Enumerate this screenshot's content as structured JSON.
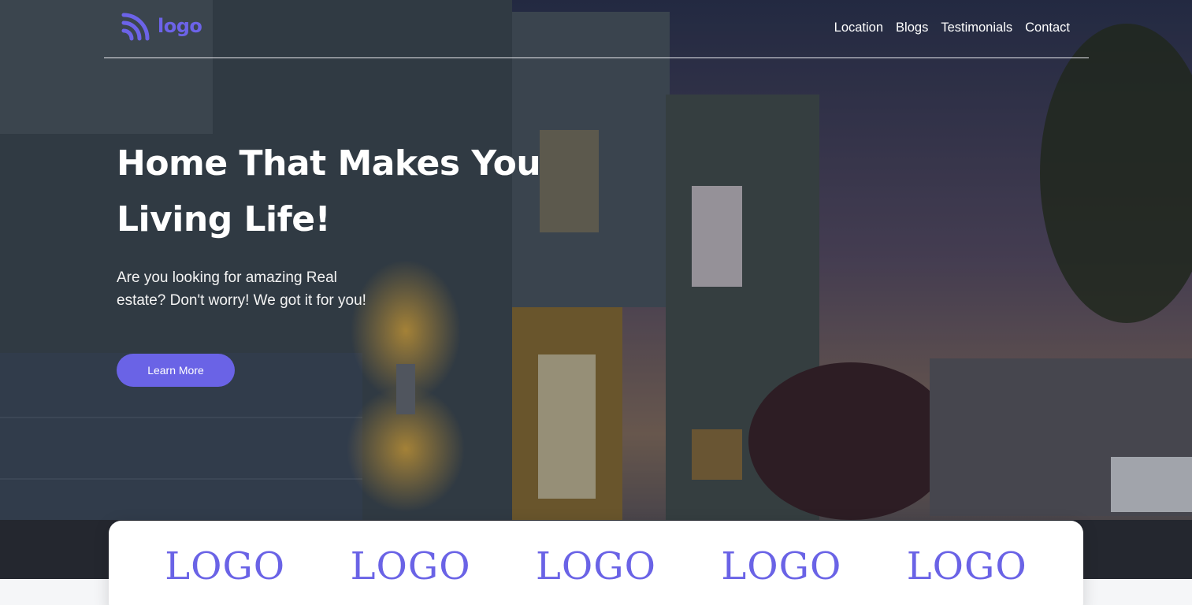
{
  "brand": {
    "logo_text": "logo",
    "accent": "#6a63e6"
  },
  "nav": {
    "items": [
      "Location",
      "Blogs",
      "Testimonials",
      "Contact"
    ]
  },
  "hero": {
    "headline_line1": "Home That Makes You",
    "headline_line2": "Living Life!",
    "subtext": "Are you looking for amazing Real estate? Don't worry! We got it for you!",
    "cta_label": "Learn More",
    "background_icon": "house-photo"
  },
  "partners": {
    "logos": [
      "LOGO",
      "LOGO",
      "LOGO",
      "LOGO",
      "LOGO"
    ]
  }
}
